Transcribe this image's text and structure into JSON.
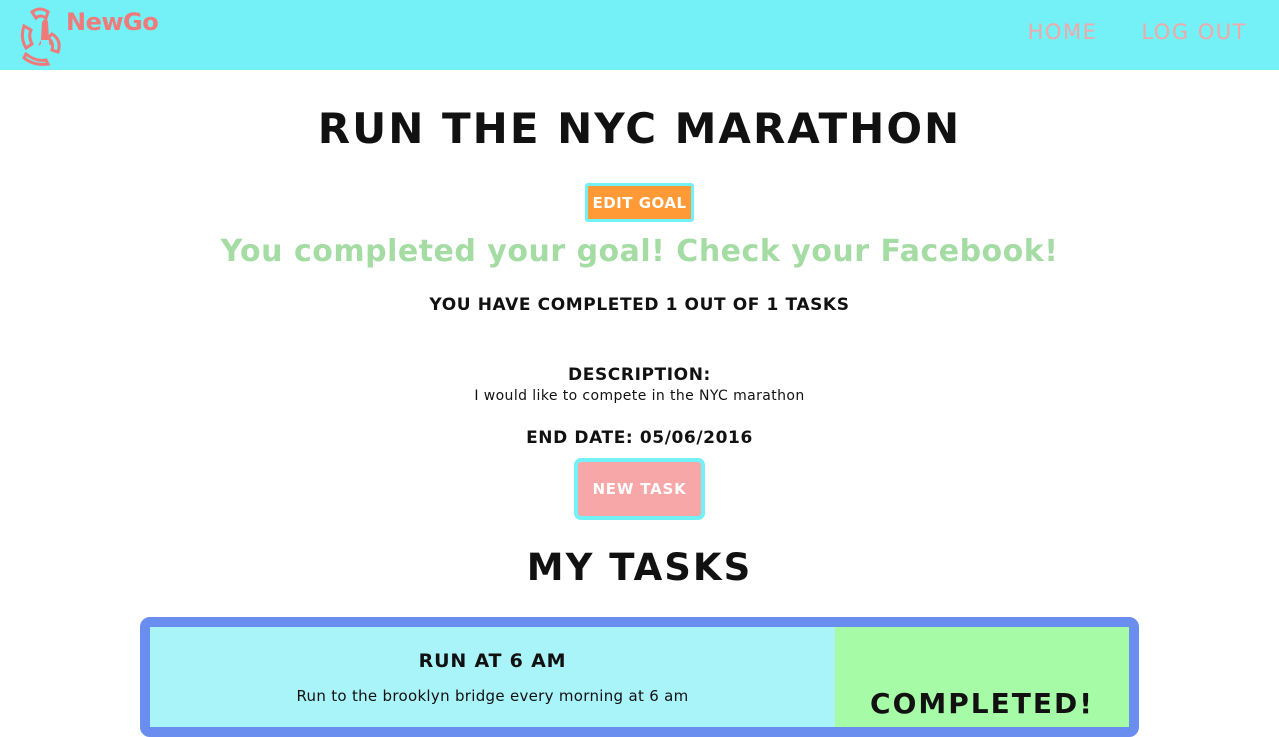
{
  "nav": {
    "logo_text": "NewGo",
    "links": [
      "HOME",
      "LOG OUT"
    ]
  },
  "goal": {
    "title": "RUN THE NYC MARATHON",
    "edit_label": "EDIT GOAL",
    "completed_message": "You completed your goal! Check your Facebook!",
    "progress_text": "YOU HAVE COMPLETED 1 OUT OF 1 TASKS",
    "description_label": "DESCRIPTION:",
    "description": "I would like to compete in the NYC marathon",
    "end_date": "END DATE: 05/06/2016",
    "new_task_label": "NEW TASK"
  },
  "tasks_heading": "MY TASKS",
  "tasks": [
    {
      "title": "RUN AT 6 AM",
      "description": "Run to the brooklyn bridge every morning at 6 am",
      "status": "COMPLETED!"
    }
  ],
  "colors": {
    "nav_bg": "#74f0f7",
    "brand": "#f07a7a",
    "nav_link": "#f3a7a7",
    "edit_button": "#ff9a36",
    "completed_text": "#a4dca4",
    "new_task_button": "#f7a7a7",
    "task_border": "#6a8df0",
    "task_bg": "#a8f4f8",
    "task_status_bg": "#a6fca6"
  }
}
